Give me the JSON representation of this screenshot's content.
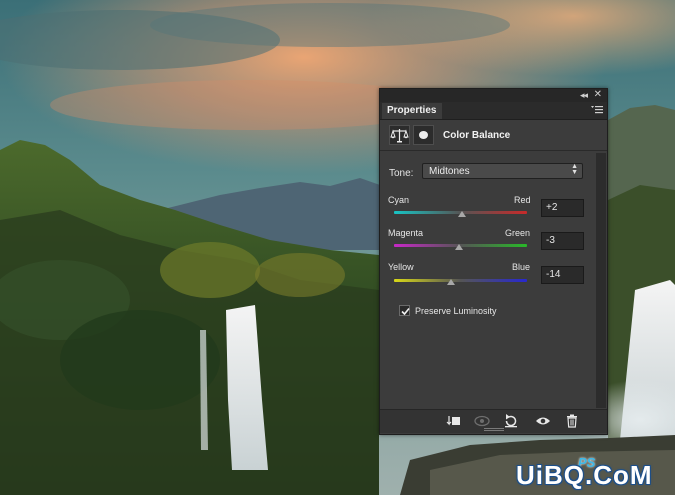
{
  "panel": {
    "tab_label": "Properties",
    "title": "Color Balance",
    "tone_label": "Tone:",
    "tone_value": "Midtones",
    "sliders": [
      {
        "left_label": "Cyan",
        "right_label": "Red",
        "value": "+2",
        "numeric": 2
      },
      {
        "left_label": "Magenta",
        "right_label": "Green",
        "value": "-3",
        "numeric": -3
      },
      {
        "left_label": "Yellow",
        "right_label": "Blue",
        "value": "-14",
        "numeric": -14
      }
    ],
    "preserve_label": "Preserve Luminosity",
    "preserve_checked": true,
    "icons": {
      "adjustment": "balance-scale-icon",
      "mask": "layer-mask-icon",
      "clip": "clip-to-layer-icon",
      "view_previous": "view-previous-icon",
      "reset": "reset-icon",
      "visibility": "eye-icon",
      "delete": "trash-icon",
      "menu": "panel-menu-icon",
      "collapse": "collapse-icon",
      "close": "close-icon"
    }
  },
  "watermark": {
    "text": "UiBQ.CoM",
    "logo": "PS"
  },
  "colors": {
    "panel_bg": "#3c3c3c",
    "cyan": "#18c4c4",
    "red": "#c82a2a",
    "magenta": "#c828c8",
    "green": "#28b828",
    "yellow": "#d8d818",
    "blue": "#2828d0"
  }
}
